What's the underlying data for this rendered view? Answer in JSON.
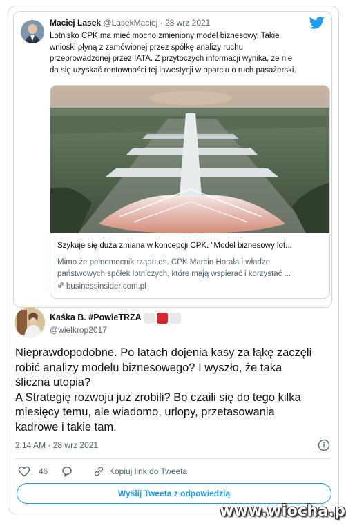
{
  "quoted_tweet": {
    "author_name": "Maciej Lasek",
    "author_handle": "@LasekMaciej",
    "separator": "·",
    "date": "28 wrz 2021",
    "text_lines": [
      "Lotnisko CPK ma mieć mocno zmieniony model biznesowy. Takie",
      "wnioski płyną z zamówionej przez spółkę analizy ruchu",
      "przeprowadzonej przez IATA. Z przytoczych informacji wynika, że nie",
      "da się uzyskać rentowności tej inwestycji w oparciu o ruch pasażerski."
    ],
    "link_card": {
      "title": "Szykuje się duża zmiana w koncepcji CPK. \"Model biznesowy lot...",
      "description_lines": [
        "Mimo że pełnomocnik rządu ds. CPK Marcin Horała i władze",
        "państwowych spółek lotniczych, które mają wspierać i korzystać ..."
      ],
      "domain": "businessinsider.com.pl"
    }
  },
  "main_tweet": {
    "author_name": "Kaśka B. #PowieTRZA",
    "author_handle": "@wielkrop2017",
    "text_lines": [
      "Nieprawdopodobne. Po latach dojenia kasy za łąkę zaczęli",
      "robić analizy modelu biznesowego? I wyszło, że taka",
      "śliczna utopia?",
      "A Strategię rozwoju już zrobili? Bo czaili się do tego kilka",
      "miesięcy temu, ale wiadomo, urlopy, przetasowania",
      "kadrowe i takie tam."
    ],
    "time": "2:14 AM",
    "separator": "·",
    "date": "28 wrz 2021",
    "likes_count": "46",
    "copy_link_label": "Kopiuj link do Tweeta",
    "reply_button_label": "Wyślij Tweeta z odpowiedzią"
  },
  "watermark": "www.wiocha.pl",
  "colors": {
    "accent": "#1d9bf0",
    "text": "#0f1419",
    "secondary": "#536471",
    "border": "#cfd9de"
  },
  "icons": [
    "twitter-bird-icon",
    "link-icon",
    "info-icon",
    "heart-icon",
    "reply-bubble-icon",
    "link-chain-icon"
  ]
}
